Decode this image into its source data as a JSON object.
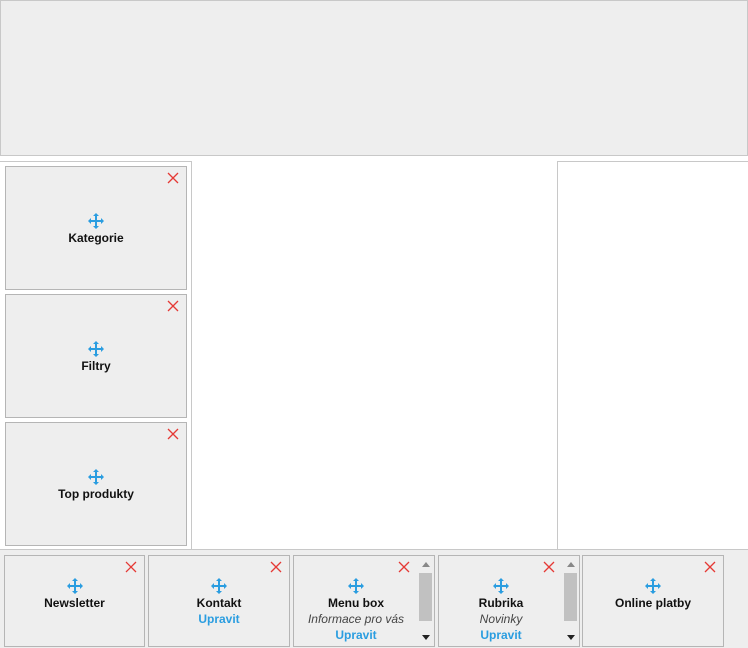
{
  "colors": {
    "close": "#e53935",
    "move": "#2a9de0",
    "edit": "#2a9de0"
  },
  "left_widgets": [
    {
      "title": "Kategorie"
    },
    {
      "title": "Filtry"
    },
    {
      "title": "Top produkty"
    }
  ],
  "bottom_widgets": [
    {
      "title": "Newsletter"
    },
    {
      "title": "Kontakt",
      "edit": "Upravit"
    },
    {
      "title": "Menu box",
      "subtitle": "Informace pro vás",
      "edit": "Upravit"
    },
    {
      "title": "Rubrika",
      "subtitle": "Novinky",
      "edit": "Upravit"
    },
    {
      "title": "Online platby"
    }
  ],
  "icons": {
    "close": "close-x-icon",
    "move": "move-arrows-icon"
  }
}
